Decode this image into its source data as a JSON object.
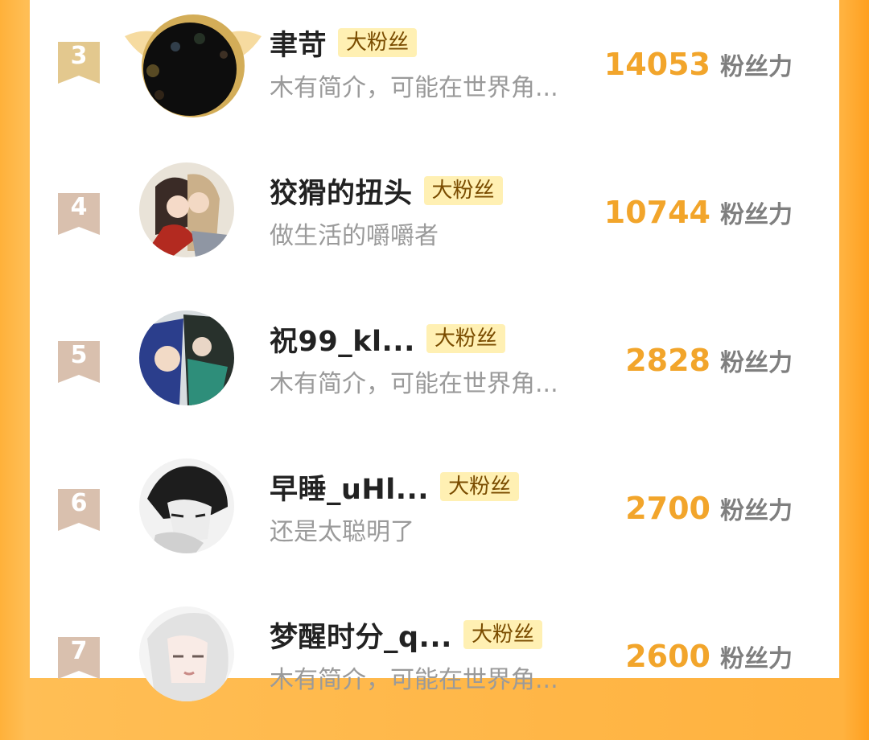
{
  "badge_label": "大粉丝",
  "score_unit": "粉丝力",
  "rows": [
    {
      "rank": "3",
      "name": "聿苛",
      "bio": "木有简介，可能在世界角...",
      "score": "14053"
    },
    {
      "rank": "4",
      "name": "狡猾的扭头",
      "bio": "做生活的嚼嚼者",
      "score": "10744"
    },
    {
      "rank": "5",
      "name": "祝99_kl...",
      "bio": "木有简介，可能在世界角...",
      "score": "2828"
    },
    {
      "rank": "6",
      "name": "早睡_uHl...",
      "bio": "还是太聪明了",
      "score": "2700"
    },
    {
      "rank": "7",
      "name": "梦醒时分_q...",
      "bio": "木有简介，可能在世界角...",
      "score": "2600"
    }
  ],
  "colors": {
    "background": "#ffb23f",
    "score": "#f2a52b",
    "badge_bg": "#fff0b3",
    "rank3_ribbon": "#e3c88e",
    "rank_ribbon": "#d9c0ae"
  }
}
